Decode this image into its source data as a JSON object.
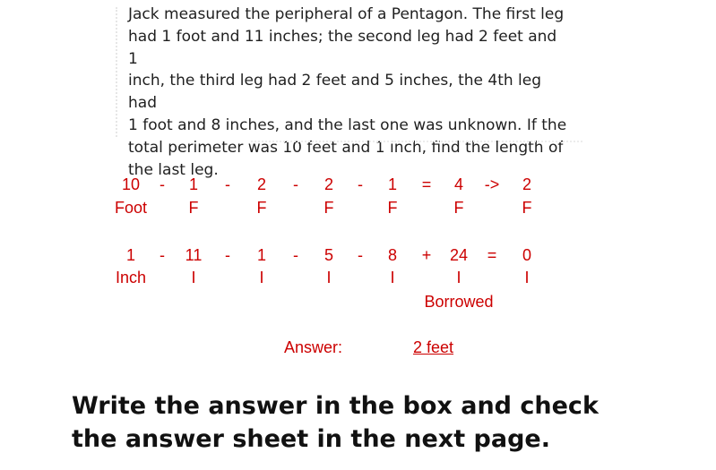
{
  "problem": {
    "lines": [
      "Jack measured the peripheral of a Pentagon. The first leg",
      "had 1 foot and 11 inches; the second leg had 2 feet and 1",
      "inch, the third leg had 2 feet and 5 inches, the 4th leg had",
      "1 foot and 8 inches, and the last one was unknown. If the",
      "total perimeter was 10 feet and 1 inch, find the length of",
      "the last leg."
    ]
  },
  "calc": {
    "feet_row": [
      "10",
      "-",
      "1",
      "-",
      "2",
      "-",
      "2",
      "-",
      "1",
      "=",
      "4",
      "->",
      "2"
    ],
    "feet_units": [
      "Foot",
      "F",
      "F",
      "F",
      "F",
      "F",
      "F"
    ],
    "inch_row": [
      "1",
      "-",
      "11",
      "-",
      "1",
      "-",
      "5",
      "-",
      "8",
      "+",
      "24",
      "=",
      "0"
    ],
    "inch_units": [
      "Inch",
      "I",
      "I",
      "I",
      "I",
      "I",
      "I"
    ],
    "borrowed": "Borrowed"
  },
  "answer": {
    "label": "Answer:",
    "value": "2 feet"
  },
  "instruction": [
    "Write the answer in the box and check",
    "the answer sheet in the next page."
  ],
  "colors": {
    "accent": "#cc0000",
    "text": "#1f1f1f"
  }
}
